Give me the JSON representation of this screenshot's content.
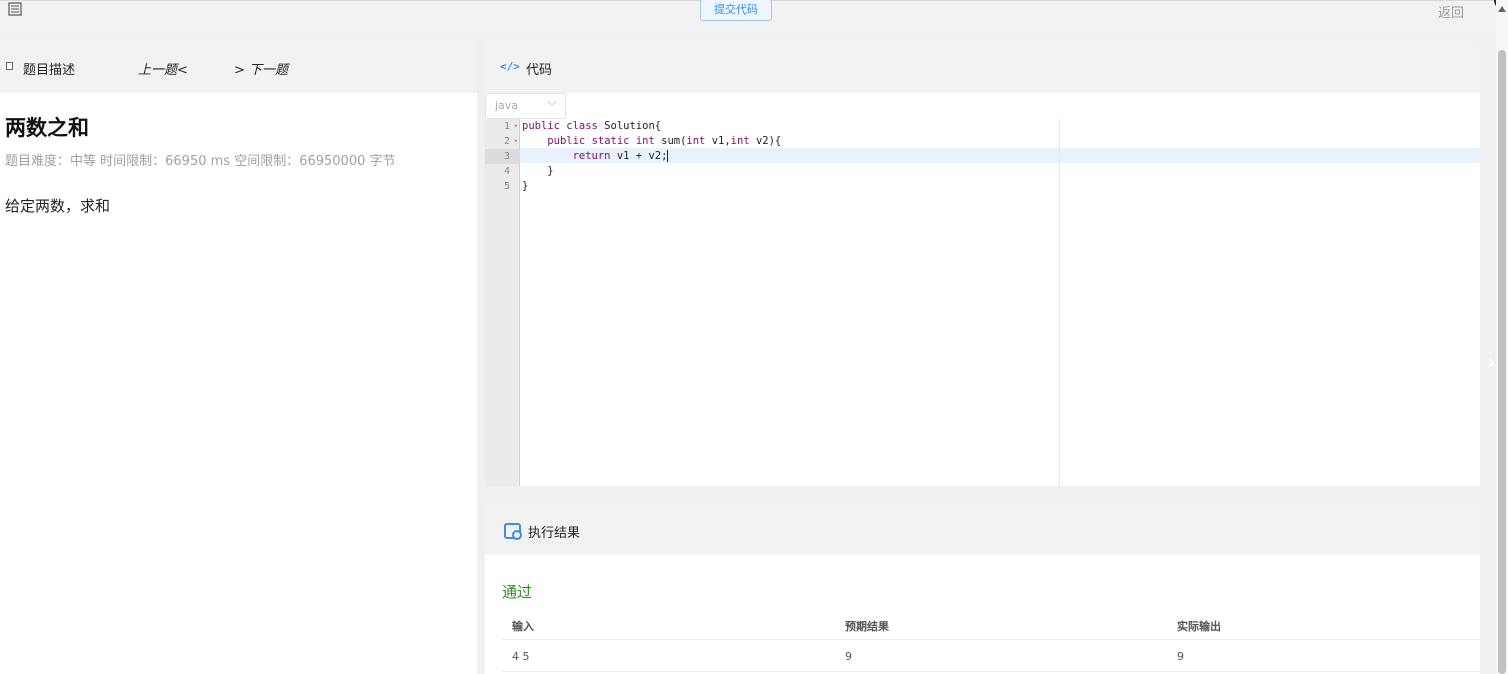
{
  "topbar": {
    "submit_label": "提交代码",
    "back_label": "返回"
  },
  "problem": {
    "tab_label": "题目描述",
    "prev_label": "上一题<",
    "next_label": "> 下一题",
    "title": "两数之和",
    "meta": "题目难度：中等 时间限制：66950 ms 空间限制：66950000 字节",
    "description": "给定两数，求和"
  },
  "editor": {
    "header_label": "代码",
    "header_icon": "code-icon",
    "language": "java",
    "line_numbers": [
      "1",
      "2",
      "3",
      "4",
      "5"
    ],
    "active_line": 3,
    "lines": {
      "l1_kw1": "public",
      "l1_kw2": "class",
      "l1_rest": " Solution{",
      "l2_indent": "    ",
      "l2_kw1": "public",
      "l2_kw2": "static",
      "l2_kw3": "int",
      "l2_mid": " sum(",
      "l2_kw4": "int",
      "l2_mid2": " v1,",
      "l2_kw5": "int",
      "l2_rest": " v2){",
      "l3_indent": "        ",
      "l3_kw1": "return",
      "l3_rest": " v1 + v2;",
      "l4": "    }",
      "l5": "}"
    }
  },
  "result": {
    "header_label": "执行结果",
    "status": "通过",
    "status_color": "#2f8f22",
    "columns": [
      "输入",
      "预期结果",
      "实际输出"
    ],
    "rows": [
      [
        "4 5",
        "9",
        "9"
      ]
    ]
  },
  "colors": {
    "accent": "#3a8ee6",
    "keyword": "#8a0e6e"
  }
}
